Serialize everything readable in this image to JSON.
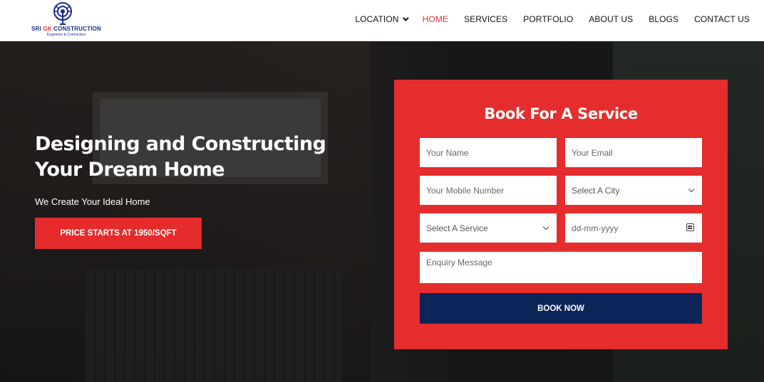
{
  "brand": {
    "logo_prefix": "SRI ",
    "logo_highlight": "GK",
    "logo_suffix": " CONSTRUCTION",
    "logo_tagline": "Engineers & Contractors"
  },
  "nav": {
    "items": [
      {
        "label": "LOCATION",
        "has_dropdown": true,
        "active": false
      },
      {
        "label": "HOME",
        "active": true
      },
      {
        "label": "SERVICES",
        "active": false
      },
      {
        "label": "PORTFOLIO",
        "active": false
      },
      {
        "label": "ABOUT US",
        "active": false
      },
      {
        "label": "BLOGS",
        "active": false
      },
      {
        "label": "CONTACT US",
        "active": false
      }
    ]
  },
  "hero": {
    "title": "Designing and Constructing Your Dream Home",
    "subtitle": "We Create Your Ideal Home",
    "price_button": "PRICE STARTS AT 1950/SQFT"
  },
  "form": {
    "title": "Book For A Service",
    "name_placeholder": "Your Name",
    "email_placeholder": "Your Email",
    "mobile_placeholder": "Your Mobile Number",
    "city_select": "Select A City",
    "service_select": "Select A Service",
    "date_placeholder": "dd-mm-yyyy",
    "message_placeholder": "Enquiry Message",
    "submit_label": "BOOK NOW"
  },
  "colors": {
    "accent_red": "#e52d2d",
    "submit_navy": "#0c2457",
    "nav_active": "#e8302f"
  }
}
